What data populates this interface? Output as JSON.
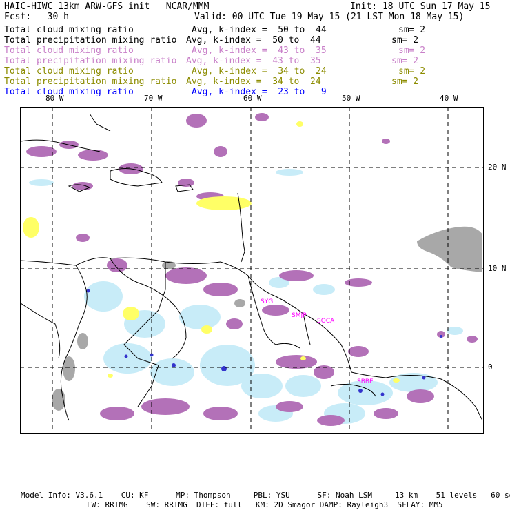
{
  "header": {
    "title": "HAIC-HIWC 13km ARW-GFS init   NCAR/MMM",
    "init": "Init: 18 UTC Sun 17 May 15",
    "fcst": "Fcst:   30 h",
    "valid": "Valid: 00 UTC Tue 19 May 15 (21 LST Mon 18 May 15)"
  },
  "legend": [
    {
      "field": "Total cloud mixing ratio",
      "avg": "Avg, k-index =  50 to  44",
      "sm": "sm= 2",
      "color": "#000000"
    },
    {
      "field": "Total precipitation mixing ratio",
      "avg": "Avg, k-index =  50 to  44",
      "sm": "sm= 2",
      "color": "#000000"
    },
    {
      "field": "Total cloud mixing ratio",
      "avg": "Avg, k-index =  43 to  35",
      "sm": "sm= 2",
      "color": "#c87fc8"
    },
    {
      "field": "Total precipitation mixing ratio",
      "avg": "Avg, k-index =  43 to  35",
      "sm": "sm= 2",
      "color": "#c87fc8"
    },
    {
      "field": "Total cloud mixing ratio",
      "avg": "Avg, k-index =  34 to  24",
      "sm": "sm= 2",
      "color": "#8c8c00"
    },
    {
      "field": "Total precipitation mixing ratio",
      "avg": "Avg, k-index =  34 to  24",
      "sm": "sm= 2",
      "color": "#8c8c00"
    },
    {
      "field": "Total cloud mixing ratio",
      "avg": "Avg, k-index =  23 to   9",
      "sm": "",
      "color": "#0000ff"
    }
  ],
  "lon_labels": [
    "80 W",
    "70 W",
    "60 W",
    "50 W",
    "40 W"
  ],
  "lat_labels": [
    "20 N",
    "10 N",
    "0"
  ],
  "stations": [
    "SYGL",
    "SMJP",
    "SOCA",
    "SBBE"
  ],
  "colors": {
    "purple_cloud": "#b371b8",
    "gray_cloud": "#a8a8a8",
    "yellow_precip": "#ffff66",
    "lightblue_precip": "#c8ecf8",
    "blue_core": "#3333cc",
    "station": "#ff00ff"
  },
  "footer": {
    "line1": "Model Info: V3.6.1    CU: KF      MP: Thompson     PBL: YSU      SF: Noah LSM     13 km    51 levels   60 sec",
    "line2": "LW: RRTMG    SW: RRTMG  DIFF: full   KM: 2D Smagor DAMP: Rayleigh3  SFLAY: MM5"
  }
}
